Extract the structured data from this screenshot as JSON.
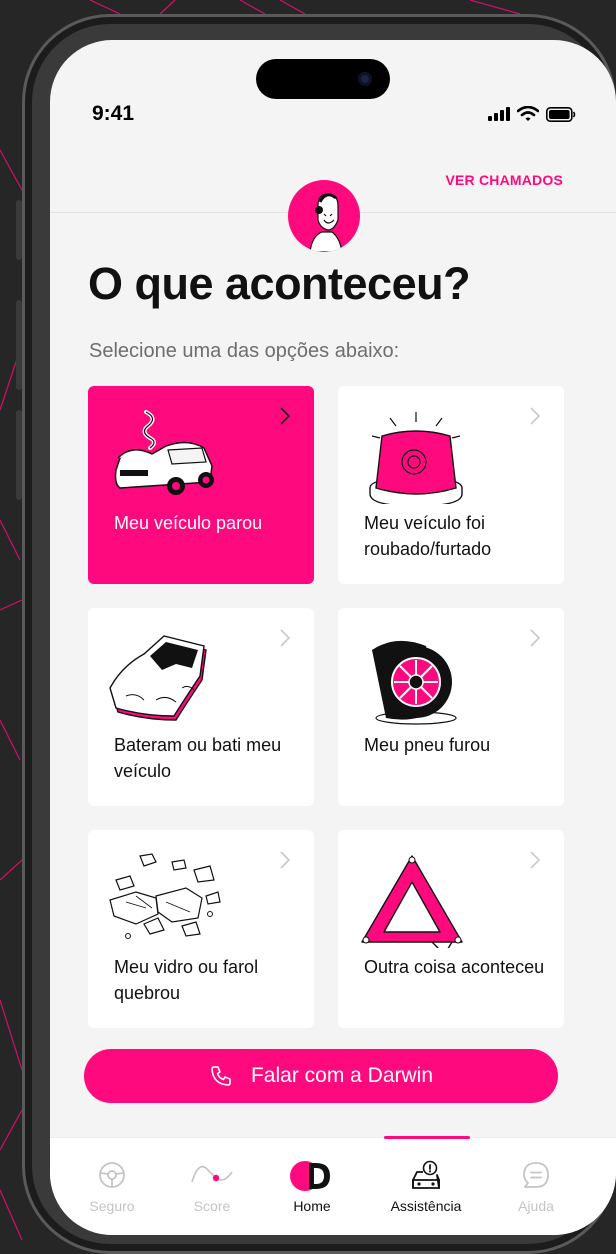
{
  "status_bar": {
    "time": "9:41"
  },
  "header": {
    "ver_chamados": "VER CHAMADOS"
  },
  "main": {
    "title": "O que aconteceu?",
    "subtitle": "Selecione uma das opções abaixo:",
    "options": [
      {
        "label": "Meu veículo parou",
        "icon": "broken-car-icon",
        "selected": true
      },
      {
        "label": "Meu veículo foi roubado/furtado",
        "icon": "siren-icon",
        "selected": false
      },
      {
        "label": "Bateram ou bati meu veículo",
        "icon": "crash-icon",
        "selected": false
      },
      {
        "label": "Meu pneu furou",
        "icon": "flat-tire-icon",
        "selected": false
      },
      {
        "label": "Meu vidro ou farol quebrou",
        "icon": "broken-glass-icon",
        "selected": false
      },
      {
        "label": "Outra coisa aconteceu",
        "icon": "warning-triangle-icon",
        "selected": false
      }
    ],
    "cta": {
      "label": "Falar com a Darwin",
      "icon": "phone-icon"
    }
  },
  "tabbar": {
    "tabs": [
      {
        "label": "Seguro",
        "icon": "steering-wheel-icon",
        "active": false
      },
      {
        "label": "Score",
        "icon": "route-icon",
        "active": false
      },
      {
        "label": "Home",
        "icon": "darwin-logo-icon",
        "active": true
      },
      {
        "label": "Assistência",
        "icon": "car-assistance-icon",
        "active": true
      },
      {
        "label": "Ajuda",
        "icon": "chat-help-icon",
        "active": false
      }
    ]
  },
  "colors": {
    "accent": "#ff0a7e",
    "background": "#f4f4f4",
    "card": "#ffffff",
    "text": "#111111",
    "muted": "#6e6e6e",
    "tab_inactive": "#c4c4c4"
  }
}
